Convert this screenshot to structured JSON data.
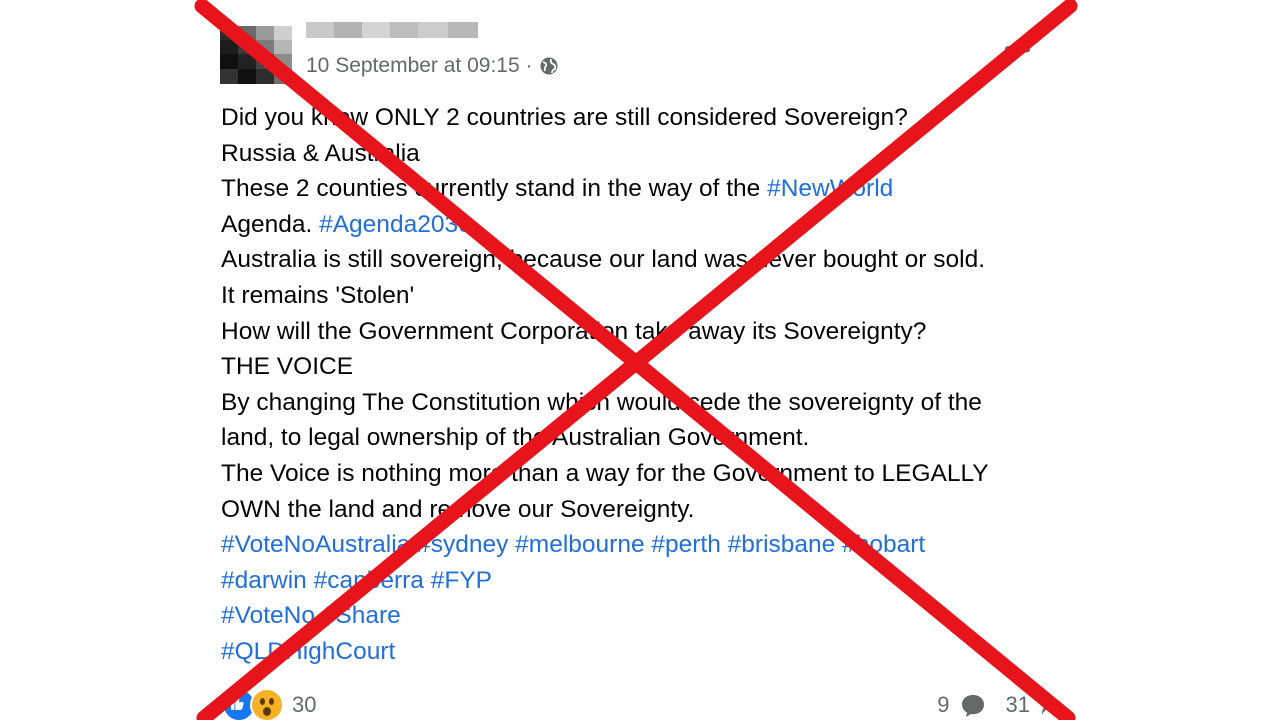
{
  "post": {
    "timestamp": "10 September at 09:15",
    "separator": "·",
    "privacy_icon": "globe-icon",
    "more_icon": "more-dots-icon",
    "lines": [
      [
        {
          "t": "Did you know ONLY 2 countries are still considered Sovereign?",
          "tag": false
        }
      ],
      [
        {
          "t": "Russia & Australia",
          "tag": false
        }
      ],
      [
        {
          "t": "These 2 counties currently stand in the way of the ",
          "tag": false
        },
        {
          "t": "#NewWorld",
          "tag": true
        }
      ],
      [
        {
          "t": "Agenda. ",
          "tag": false
        },
        {
          "t": "#Agenda2030",
          "tag": true
        }
      ],
      [
        {
          "t": "Australia is still sovereign, because our land was never bought or sold.",
          "tag": false
        }
      ],
      [
        {
          "t": "It remains 'Stolen'",
          "tag": false
        }
      ],
      [
        {
          "t": "How will the Government Corporation take away its Sovereignty?",
          "tag": false
        }
      ],
      [
        {
          "t": "THE VOICE",
          "tag": false
        }
      ],
      [
        {
          "t": "By changing The Constitution which would cede the sovereignty of the",
          "tag": false
        }
      ],
      [
        {
          "t": "land, to legal ownership of the Australian Government.",
          "tag": false
        }
      ],
      [
        {
          "t": "The Voice is nothing more than a way for the Government to LEGALLY",
          "tag": false
        }
      ],
      [
        {
          "t": "OWN the land and remove our Sovereignty.",
          "tag": false
        }
      ],
      [
        {
          "t": "#VoteNoAustralia #sydney #melbourne #perth #brisbane #hobart",
          "tag": true
        }
      ],
      [
        {
          "t": "#darwin #canberra #FYP",
          "tag": true
        }
      ],
      [
        {
          "t": "#VoteNo #Share",
          "tag": true
        }
      ],
      [
        {
          "t": "#QLDHighCourt",
          "tag": true
        }
      ]
    ]
  },
  "footer": {
    "reaction_icons": [
      "like-reaction-icon",
      "wow-reaction-icon"
    ],
    "reaction_count": "30",
    "comment_count": "9",
    "share_count": "31"
  },
  "colors": {
    "hashtag": "#216fdb",
    "cross": "#e8141c",
    "muted": "#65676b"
  }
}
